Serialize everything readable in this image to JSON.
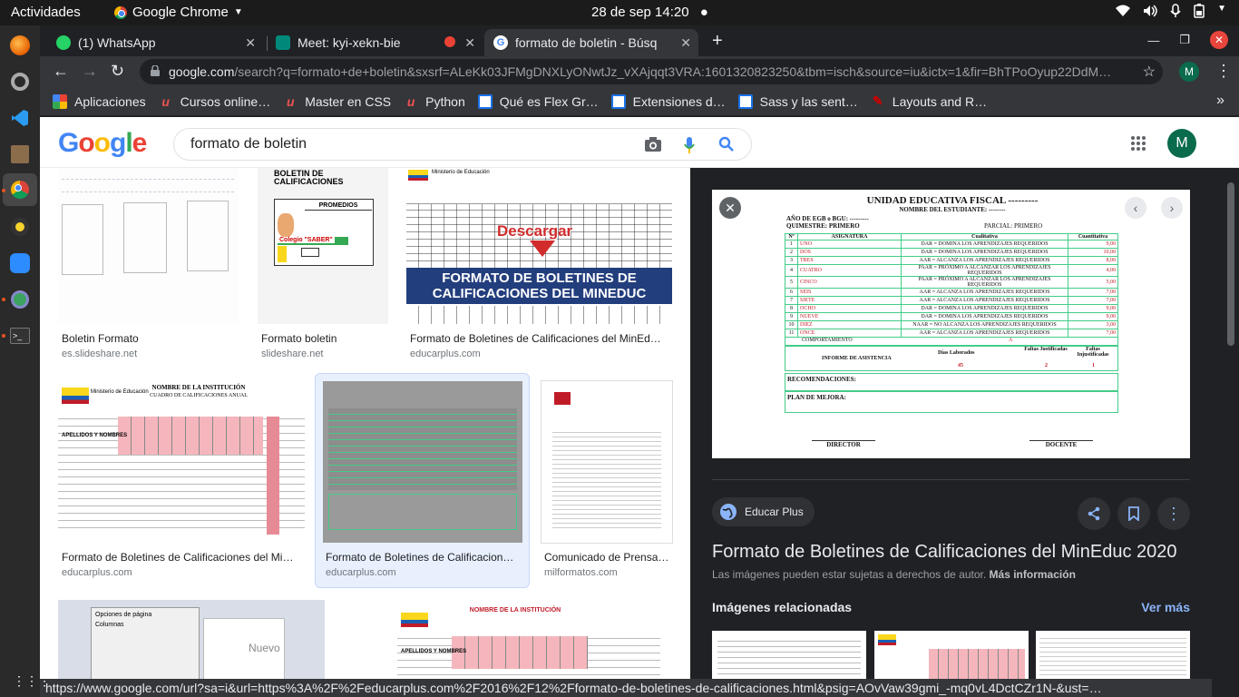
{
  "topbar": {
    "activities": "Actividades",
    "app_name": "Google Chrome",
    "clock": "28 de sep  14:20"
  },
  "tabs": [
    {
      "label": "(1) WhatsApp"
    },
    {
      "label": "Meet: kyi-xekn-bie"
    },
    {
      "label": "formato de boletin - Búsq"
    }
  ],
  "toolbar": {
    "url_host": "google.com",
    "url_rest": "/search?q=formato+de+boletin&sxsrf=ALeKk03JFMgDNXLyONwtJz_vXAjqqt3VRA:1601320823250&tbm=isch&source=iu&ictx=1&fir=BhTPoOyup22DdM…",
    "profile_initial": "M"
  },
  "bookmarks": [
    {
      "label": "Aplicaciones"
    },
    {
      "label": "Cursos online…"
    },
    {
      "label": "Master en CSS"
    },
    {
      "label": "Python"
    },
    {
      "label": "Qué es Flex Gr…"
    },
    {
      "label": "Extensiones d…"
    },
    {
      "label": "Sass y las sent…"
    },
    {
      "label": "Layouts and R…"
    }
  ],
  "google": {
    "logo": "Google",
    "query": "formato de boletin",
    "avatar_initial": "M"
  },
  "results": [
    {
      "title": "Boletin Formato",
      "source": "es.slideshare.net"
    },
    {
      "title": "Formato boletin",
      "source": "slideshare.net"
    },
    {
      "title": "Formato de Boletines de Calificaciones del MinEd…",
      "source": "educarplus.com"
    },
    {
      "title": "Formato de Boletines de Calificaciones del Mi…",
      "source": "educarplus.com"
    },
    {
      "title": "Formato de Boletines de Calificacion…",
      "source": "educarplus.com"
    },
    {
      "title": "Comunicado de Prensa…",
      "source": "milformatos.com"
    }
  ],
  "thumbs": {
    "promedios": "PROMEDIOS",
    "boletin_calif": "BOLETIN DE CALIFICACIONES",
    "colegio": "Colegio \"SABER\"",
    "descargar": "Descargar",
    "banner_line1": "FORMATO DE BOLETINES DE",
    "banner_line2": "CALIFICACIONES DEL MINEDUC",
    "ministerio": "Ministerio de Educación",
    "nombre_inst": "NOMBRE DE LA INSTITUCIÓN",
    "cuadro": "CUADRO DE CALIFICACIONES ANUAL",
    "apellidos": "APELLIDOS Y NOMBRES",
    "nuevo": "Nuevo",
    "opciones": "Opciones de página",
    "columnas": "Columnas"
  },
  "panel": {
    "preview": {
      "header": "UNIDAD EDUCATIVA FISCAL ---------",
      "student": "NOMBRE DEL ESTUDIANTE: --------",
      "grade": "AÑO DE EGB o BGU: ---------",
      "quimestre": "QUIMESTRE: PRIMERO",
      "parcial": "PARCIAL: PRIMERO",
      "col_n": "Nº",
      "col_subject": "ASIGNATURA",
      "col_qual": "Cualitativa",
      "col_quant": "Cuantitativa",
      "rows": [
        {
          "n": "1",
          "subject": "UNO",
          "qual": "DAR = DOMINA LOS APRENDIZAJES REQUERIDOS",
          "quant": "9,00"
        },
        {
          "n": "2",
          "subject": "DOS",
          "qual": "DAR = DOMINA LOS APRENDIZAJES REQUERIDOS",
          "quant": "10,00"
        },
        {
          "n": "3",
          "subject": "TRES",
          "qual": "AAR = ALCANZA LOS APRENDIZAJES REQUERIDOS",
          "quant": "8,00"
        },
        {
          "n": "4",
          "subject": "CUATRO",
          "qual": "PAAR = PRÓXIMO A ALCANZAR LOS APRENDIZAJES REQUERIDOS",
          "quant": "4,00"
        },
        {
          "n": "5",
          "subject": "CINCO",
          "qual": "PAAR = PRÓXIMO A ALCANZAR LOS APRENDIZAJES REQUERIDOS",
          "quant": "5,00"
        },
        {
          "n": "6",
          "subject": "SEIS",
          "qual": "AAR = ALCANZA LOS APRENDIZAJES REQUERIDOS",
          "quant": "7,00"
        },
        {
          "n": "7",
          "subject": "SIETE",
          "qual": "AAR = ALCANZA LOS APRENDIZAJES REQUERIDOS",
          "quant": "7,00"
        },
        {
          "n": "8",
          "subject": "OCHO",
          "qual": "DAR = DOMINA LOS APRENDIZAJES REQUERIDOS",
          "quant": "9,00"
        },
        {
          "n": "9",
          "subject": "NUEVE",
          "qual": "DAR = DOMINA LOS APRENDIZAJES REQUERIDOS",
          "quant": "9,00"
        },
        {
          "n": "10",
          "subject": "DIEZ",
          "qual": "NAAR = NO ALCANZA LOS APRENDIZAJES REQUERIDOS",
          "quant": "3,00"
        },
        {
          "n": "11",
          "subject": "ONCE",
          "qual": "AAR = ALCANZA LOS APRENDIZAJES REQUERIDOS",
          "quant": "7,00"
        }
      ],
      "comportamiento": "COMPORTAMIENTO",
      "comportamiento_val": "A",
      "asistencia": "INFORME DE ASISTENCIA",
      "dias": "Días Laborados",
      "faltas_j": "Faltas Justificadas",
      "faltas_i": "Faltas Injustificadas",
      "dias_val": "45",
      "faltas_j_val": "2",
      "faltas_i_val": "1",
      "recomendaciones": "RECOMENDACIONES:",
      "plan": "PLAN DE MEJORA:",
      "director": "DIRECTOR",
      "docente": "DOCENTE"
    },
    "source_chip": "Educar Plus",
    "title": "Formato de Boletines de Calificaciones del MinEduc 2020",
    "copyright": "Las imágenes pueden estar sujetas a derechos de autor.",
    "more_info": "Más información",
    "related_heading": "Imágenes relacionadas",
    "see_more": "Ver más"
  },
  "statusbar": {
    "url": "https://www.google.com/url?sa=i&url=https%3A%2F%2Feducarplus.com%2F2016%2F12%2Fformato-de-boletines-de-calificaciones.html&psig=AOvVaw39gmi_-mq0vL4DctCZr1N-&ust=…"
  },
  "colors": {
    "google_blue": "#4285f4",
    "google_red": "#ea4335",
    "google_yellow": "#fbbc05",
    "google_green": "#34a853",
    "link_blue": "#8ab4f8",
    "dark_bg": "#202124",
    "toolbar_bg": "#35363a"
  }
}
